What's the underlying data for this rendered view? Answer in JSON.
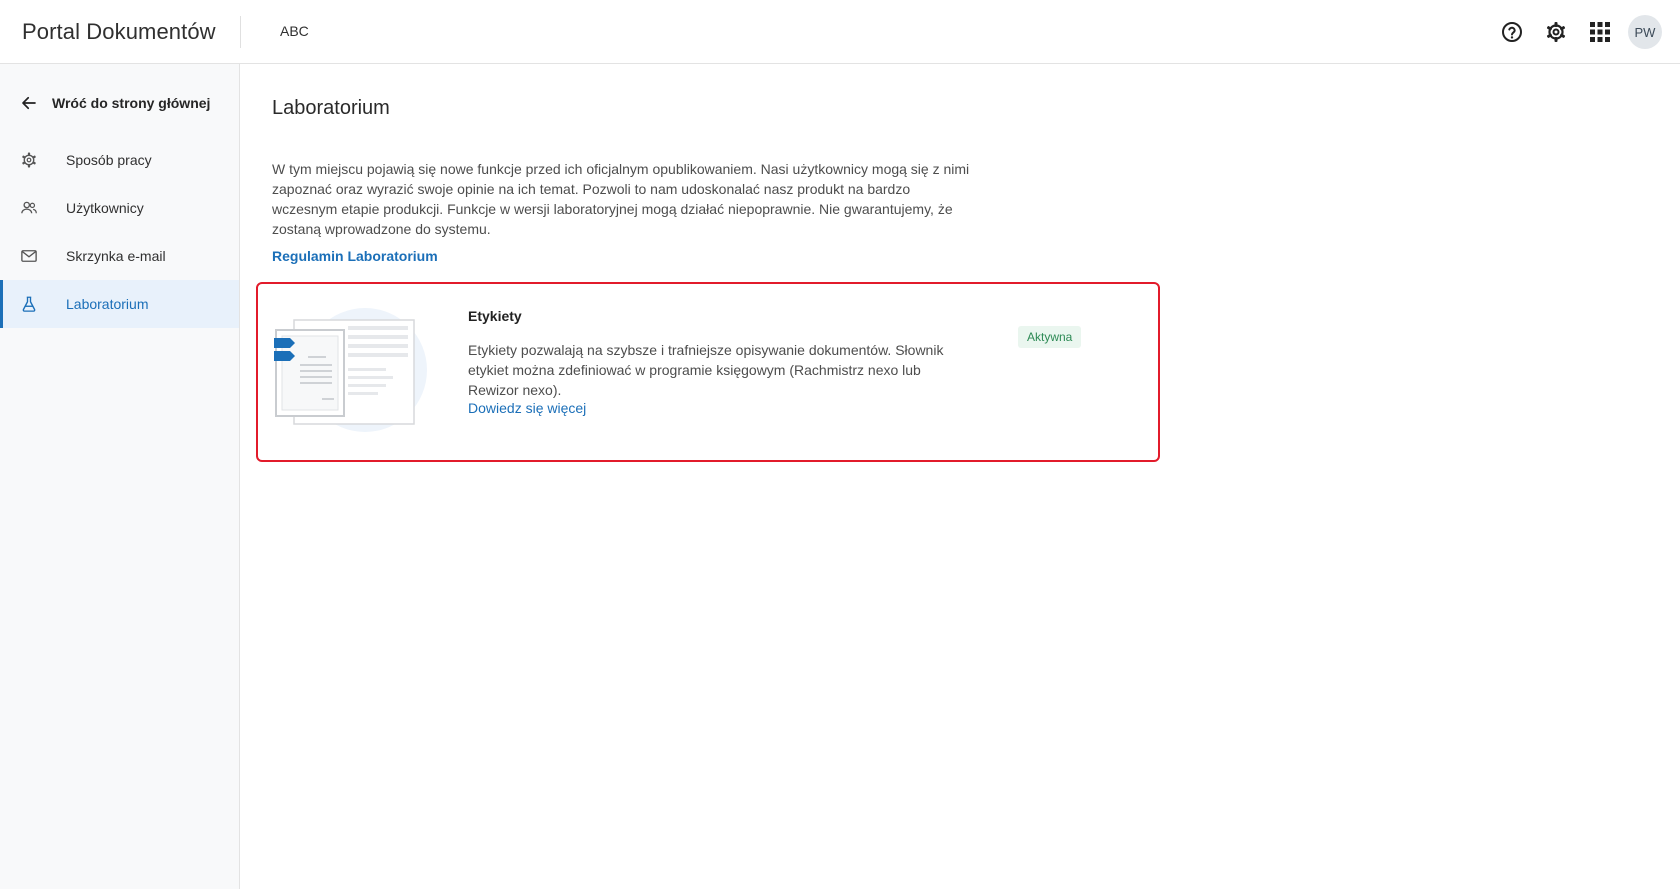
{
  "header": {
    "app_title": "Portal Dokumentów",
    "company": "ABC",
    "icons": [
      "help-icon",
      "settings-icon",
      "apps-grid-icon"
    ],
    "avatar_initials": "PW"
  },
  "sidebar": {
    "back_label": "Wróć do strony głównej",
    "items": [
      {
        "label": "Sposób pracy",
        "icon": "gear-icon"
      },
      {
        "label": "Użytkownicy",
        "icon": "users-icon"
      },
      {
        "label": "Skrzynka e-mail",
        "icon": "mail-icon"
      },
      {
        "label": "Laboratorium",
        "icon": "flask-icon",
        "active": true
      }
    ]
  },
  "main": {
    "title": "Laboratorium",
    "description": "W tym miejscu pojawią się nowe funkcje przed ich oficjalnym opublikowaniem. Nasi użytkownicy mogą się z nimi zapoznać oraz wyrazić swoje opinie na ich temat. Pozwoli to nam udoskonalać nasz produkt na bardzo wczesnym etapie produkcji. Funkcje w wersji laboratoryjnej mogą działać niepoprawnie. Nie gwarantujemy, że zostaną wprowadzone do systemu.",
    "rules_link": "Regulamin Laboratorium",
    "feature": {
      "title": "Etykiety",
      "text": "Etykiety pozwalają na szybsze i trafniejsze opisywanie dokumentów. Słownik etykiet można zdefiniować w programie księgowym (Rachmistrz nexo lub Rewizor nexo).",
      "more_link": "Dowiedz się więcej",
      "status": "Aktywna"
    }
  },
  "colors": {
    "accent": "#1b6fb8",
    "highlight_border": "#e21b2b",
    "status_bg": "#eaf6ef",
    "status_text": "#2d8a55"
  }
}
